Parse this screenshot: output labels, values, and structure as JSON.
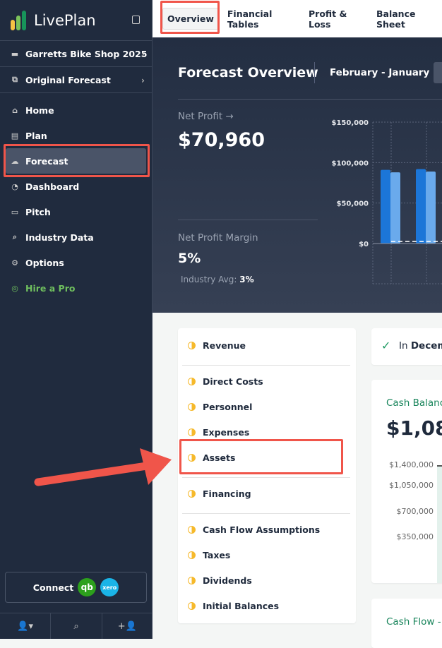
{
  "sidebar": {
    "brand": "LivePlan",
    "company": "Garretts Bike Shop 2025",
    "forecast": "Original Forecast",
    "items": [
      {
        "label": "Home",
        "icon": "home-icon"
      },
      {
        "label": "Plan",
        "icon": "plan-icon"
      },
      {
        "label": "Forecast",
        "icon": "forecast-icon",
        "active": true
      },
      {
        "label": "Dashboard",
        "icon": "dashboard-icon"
      },
      {
        "label": "Pitch",
        "icon": "pitch-icon"
      },
      {
        "label": "Industry Data",
        "icon": "industry-data-icon"
      },
      {
        "label": "Options",
        "icon": "gear-icon"
      },
      {
        "label": "Hire a Pro",
        "icon": "compass-icon"
      }
    ],
    "connect": "Connect",
    "qb": "qb",
    "xero": "xero"
  },
  "tabs": [
    "Overview",
    "Financial Tables",
    "Profit & Loss",
    "Balance Sheet"
  ],
  "hero": {
    "title": "Forecast Overview",
    "range": "February - January",
    "net_profit_label": "Net Profit →",
    "net_profit": "$70,960",
    "margin_label": "Net Profit Margin",
    "margin": "5%",
    "industry_label": "Industry Avg:",
    "industry": "3%"
  },
  "chart_data": {
    "type": "bar",
    "yticks": [
      "$150,000",
      "$100,000",
      "$50,000",
      "$0"
    ],
    "ylim": [
      0,
      150000
    ],
    "series": [
      {
        "color": "#1c76d8",
        "values": [
          91000,
          92000
        ]
      },
      {
        "color": "#6aaaec",
        "values": [
          88000,
          89000
        ]
      }
    ],
    "reference_line": 2500
  },
  "forecast_list": {
    "groups": [
      [
        "Revenue"
      ],
      [
        "Direct Costs",
        "Personnel",
        "Expenses",
        "Assets"
      ],
      [
        "Financing"
      ],
      [
        "Cash Flow Assumptions",
        "Taxes",
        "Dividends",
        "Initial Balances"
      ]
    ]
  },
  "status": {
    "prefix": "In",
    "bold": "Decem"
  },
  "cash": {
    "title": "Cash Balanc",
    "value": "$1,08",
    "yticks": [
      "$1,400,000",
      "$1,050,000",
      "$700,000",
      "$350,000"
    ]
  },
  "cashflow": {
    "title": "Cash Flow -"
  }
}
